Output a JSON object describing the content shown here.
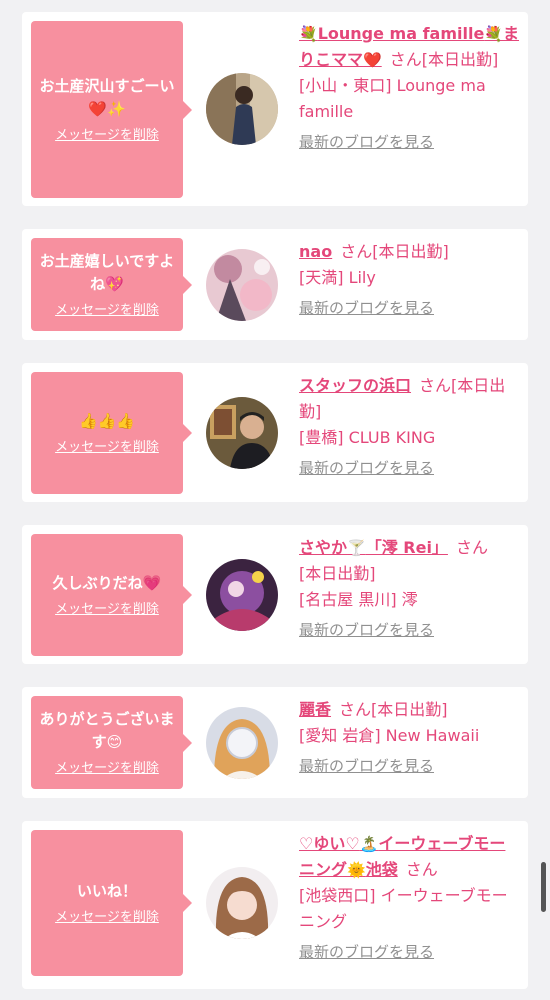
{
  "cards": [
    {
      "message": "お土産沢山すごーい❤️✨",
      "delete_label": "メッセージを削除",
      "name_parts": [
        "💐",
        "Lounge ma famille",
        "💐",
        "まりこママ",
        "❤️"
      ],
      "san": "さん",
      "status": "[本日出勤]",
      "shop": "[小山・東口] Lounge ma famille",
      "blog_label": "最新のブログを見る"
    },
    {
      "message": "お土産嬉しいですよね💖",
      "delete_label": "メッセージを削除",
      "name": "nao",
      "san": "さん",
      "status": "[本日出勤]",
      "shop": "[天満] Lily",
      "blog_label": "最新のブログを見る"
    },
    {
      "message": "👍👍👍",
      "delete_label": "メッセージを削除",
      "name": "スタッフの浜口",
      "san": "さん",
      "status": "[本日出勤]",
      "shop": "[豊橋] CLUB KING",
      "blog_label": "最新のブログを見る"
    },
    {
      "message": "久しぶりだね💗",
      "delete_label": "メッセージを削除",
      "name_parts": [
        "さやか",
        "🍸",
        "「澪 Rei」"
      ],
      "san": "さん",
      "status": "[本日出勤]",
      "shop": "[名古屋 黒川] 澪",
      "blog_label": "最新のブログを見る"
    },
    {
      "message": "ありがとうございます😊",
      "delete_label": "メッセージを削除",
      "name": "麗香",
      "san": "さん",
      "status": "[本日出勤]",
      "shop": "[愛知 岩倉] New Hawaii",
      "blog_label": "最新のブログを見る"
    },
    {
      "message": "いいね！",
      "delete_label": "メッセージを削除",
      "name_parts": [
        "♡ゆい♡",
        "🏝️",
        "イーウェーブモーニング",
        "🌞",
        "池袋"
      ],
      "san": "さん",
      "shop": "[池袋西口] イーウェーブモーニング",
      "blog_label": "最新のブログを見る"
    }
  ],
  "colors": {
    "accent": "#e4477a",
    "bubble": "#f7909f",
    "link_gray": "#909090",
    "background": "#f1f1f3"
  }
}
